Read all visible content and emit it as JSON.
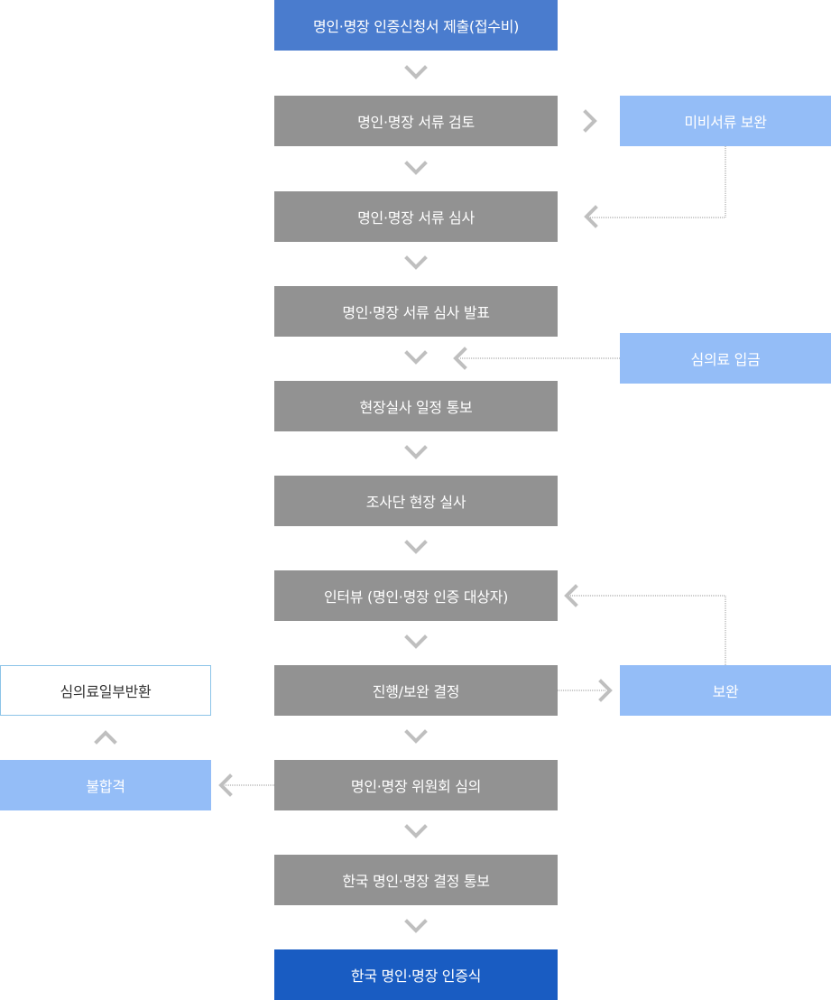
{
  "steps": [
    "명인·명장 인증신청서 제출(접수비)",
    "명인·명장 서류 검토",
    "명인·명장 서류 심사",
    "명인·명장 서류 심사 발표",
    "현장실사 일정 통보",
    "조사단 현장 실사",
    "인터뷰 (명인·명장 인증 대상자)",
    "진행/보완 결정",
    "명인·명장 위원회 심의",
    "한국 명인·명장 결정 통보",
    "한국 명인·명장 인증식"
  ],
  "side": {
    "supplement_docs": "미비서류 보완",
    "fee_payment": "심의료 입금",
    "supplement": "보완",
    "fail": "불합격",
    "partial_refund": "심의료일부반환"
  },
  "colors": {
    "step_gray": "#929292",
    "start_blue": "#4a7cce",
    "final_blue": "#195cc2",
    "side_light_blue": "#94bdf7",
    "outline_border": "#8cc4e8",
    "chevron": "#bfbfbf",
    "dotted_line": "#999999"
  }
}
